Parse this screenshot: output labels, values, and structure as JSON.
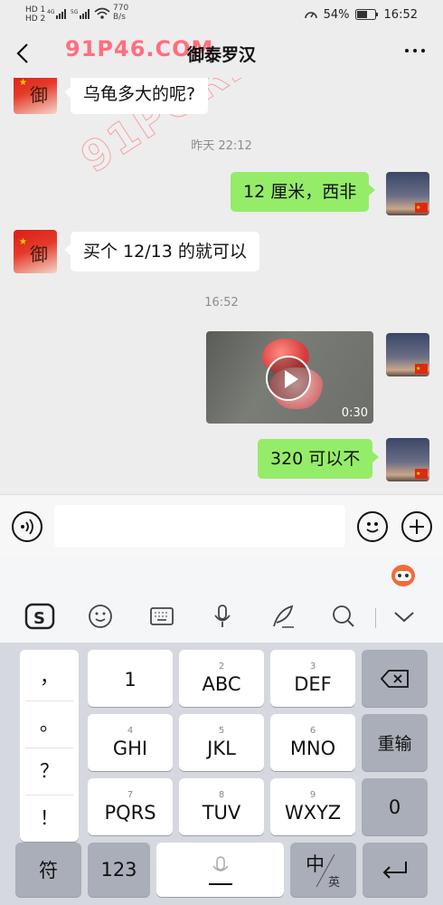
{
  "status_bar": {
    "sim1": "HD 1",
    "sim2": "HD 2",
    "net1": "4G",
    "net2": "5G",
    "net_speed_value": "770",
    "net_speed_unit": "B/s",
    "battery": "54%",
    "time": "16:52"
  },
  "header": {
    "title": "御泰罗汉",
    "watermark": "91P46.COM"
  },
  "chat": {
    "watermark": "91PORN.COM",
    "messages": [
      {
        "side": "other",
        "text": "乌龟多大的呢?"
      },
      {
        "type": "time",
        "text": "昨天 22:12"
      },
      {
        "side": "self",
        "text": "12 厘米，西非"
      },
      {
        "side": "other",
        "text": "买个 12/13 的就可以"
      },
      {
        "type": "time",
        "text": "16:52"
      },
      {
        "side": "self",
        "type": "video",
        "duration": "0:30"
      },
      {
        "side": "self",
        "text": "320 可以不"
      }
    ]
  },
  "input_bar": {
    "voice_icon": "voice-icon",
    "emoji_icon": "emoji-icon",
    "plus_icon": "plus-icon"
  },
  "keyboard_toolbar": {
    "icons": [
      "sogou-logo-icon",
      "emoji-face-icon",
      "keyboard-icon",
      "microphone-icon",
      "handwriting-feather-icon",
      "search-icon",
      "collapse-chevron-icon"
    ]
  },
  "keyboard": {
    "punctuation": [
      "，",
      "。",
      "？",
      "！"
    ],
    "keys": [
      {
        "label": "1",
        "sub": ""
      },
      {
        "label": "ABC",
        "sub": "2"
      },
      {
        "label": "DEF",
        "sub": "3"
      },
      {
        "label": "GHI",
        "sub": "4"
      },
      {
        "label": "JKL",
        "sub": "5"
      },
      {
        "label": "MNO",
        "sub": "6"
      },
      {
        "label": "PQRS",
        "sub": "7"
      },
      {
        "label": "TUV",
        "sub": "8"
      },
      {
        "label": "WXYZ",
        "sub": "9"
      }
    ],
    "reenter": "重输",
    "zero": "0",
    "symbol": "符",
    "num_mode": "123",
    "lang_main": "中",
    "lang_alt": "英"
  },
  "colors": {
    "self_bubble": "#95ec69",
    "other_bubble": "#ffffff",
    "chat_bg": "#ededed",
    "watermark": "#ff6f7f"
  }
}
